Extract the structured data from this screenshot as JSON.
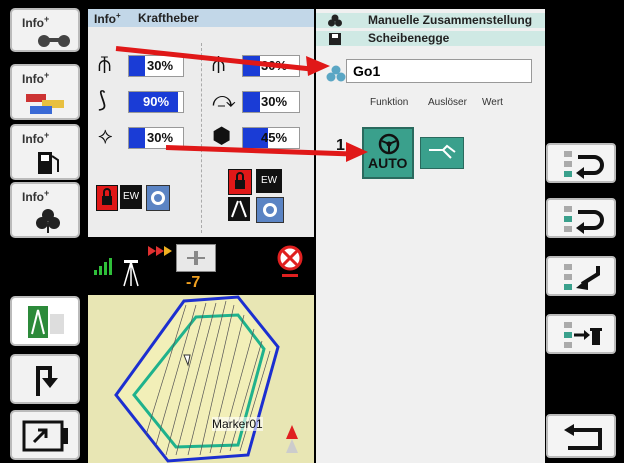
{
  "left_buttons": {
    "info_plus": "Info",
    "plus_mark": "+"
  },
  "top_panel": {
    "info_label": "Info",
    "plus_mark": "+",
    "title": "Kraftheber",
    "bars": [
      {
        "value_text": "30%",
        "fill": 0.3
      },
      {
        "value_text": "30%",
        "fill": 0.3
      },
      {
        "value_text": "90%",
        "fill": 0.9
      },
      {
        "value_text": "30%",
        "fill": 0.3
      },
      {
        "value_text": "30%",
        "fill": 0.3
      },
      {
        "value_text": "45%",
        "fill": 0.45
      }
    ],
    "ew_label": "EW"
  },
  "status": {
    "offset_value": "-7"
  },
  "map": {
    "marker_label": "Marker01"
  },
  "right_panel": {
    "header_rows": [
      "Manuelle Zusammenstellung",
      "Scheibenegge"
    ],
    "name_value": "Go1",
    "columns": [
      "Funktion",
      "Auslöser",
      "Wert"
    ],
    "row_number": "1",
    "auto_label": "AUTO"
  },
  "colors": {
    "bar_fill": "#1a3cd6",
    "header_blue": "#c2d7e8",
    "header_teal": "#cfe9e4",
    "auto_green": "#3aa08c",
    "arrow_red": "#e01818"
  }
}
